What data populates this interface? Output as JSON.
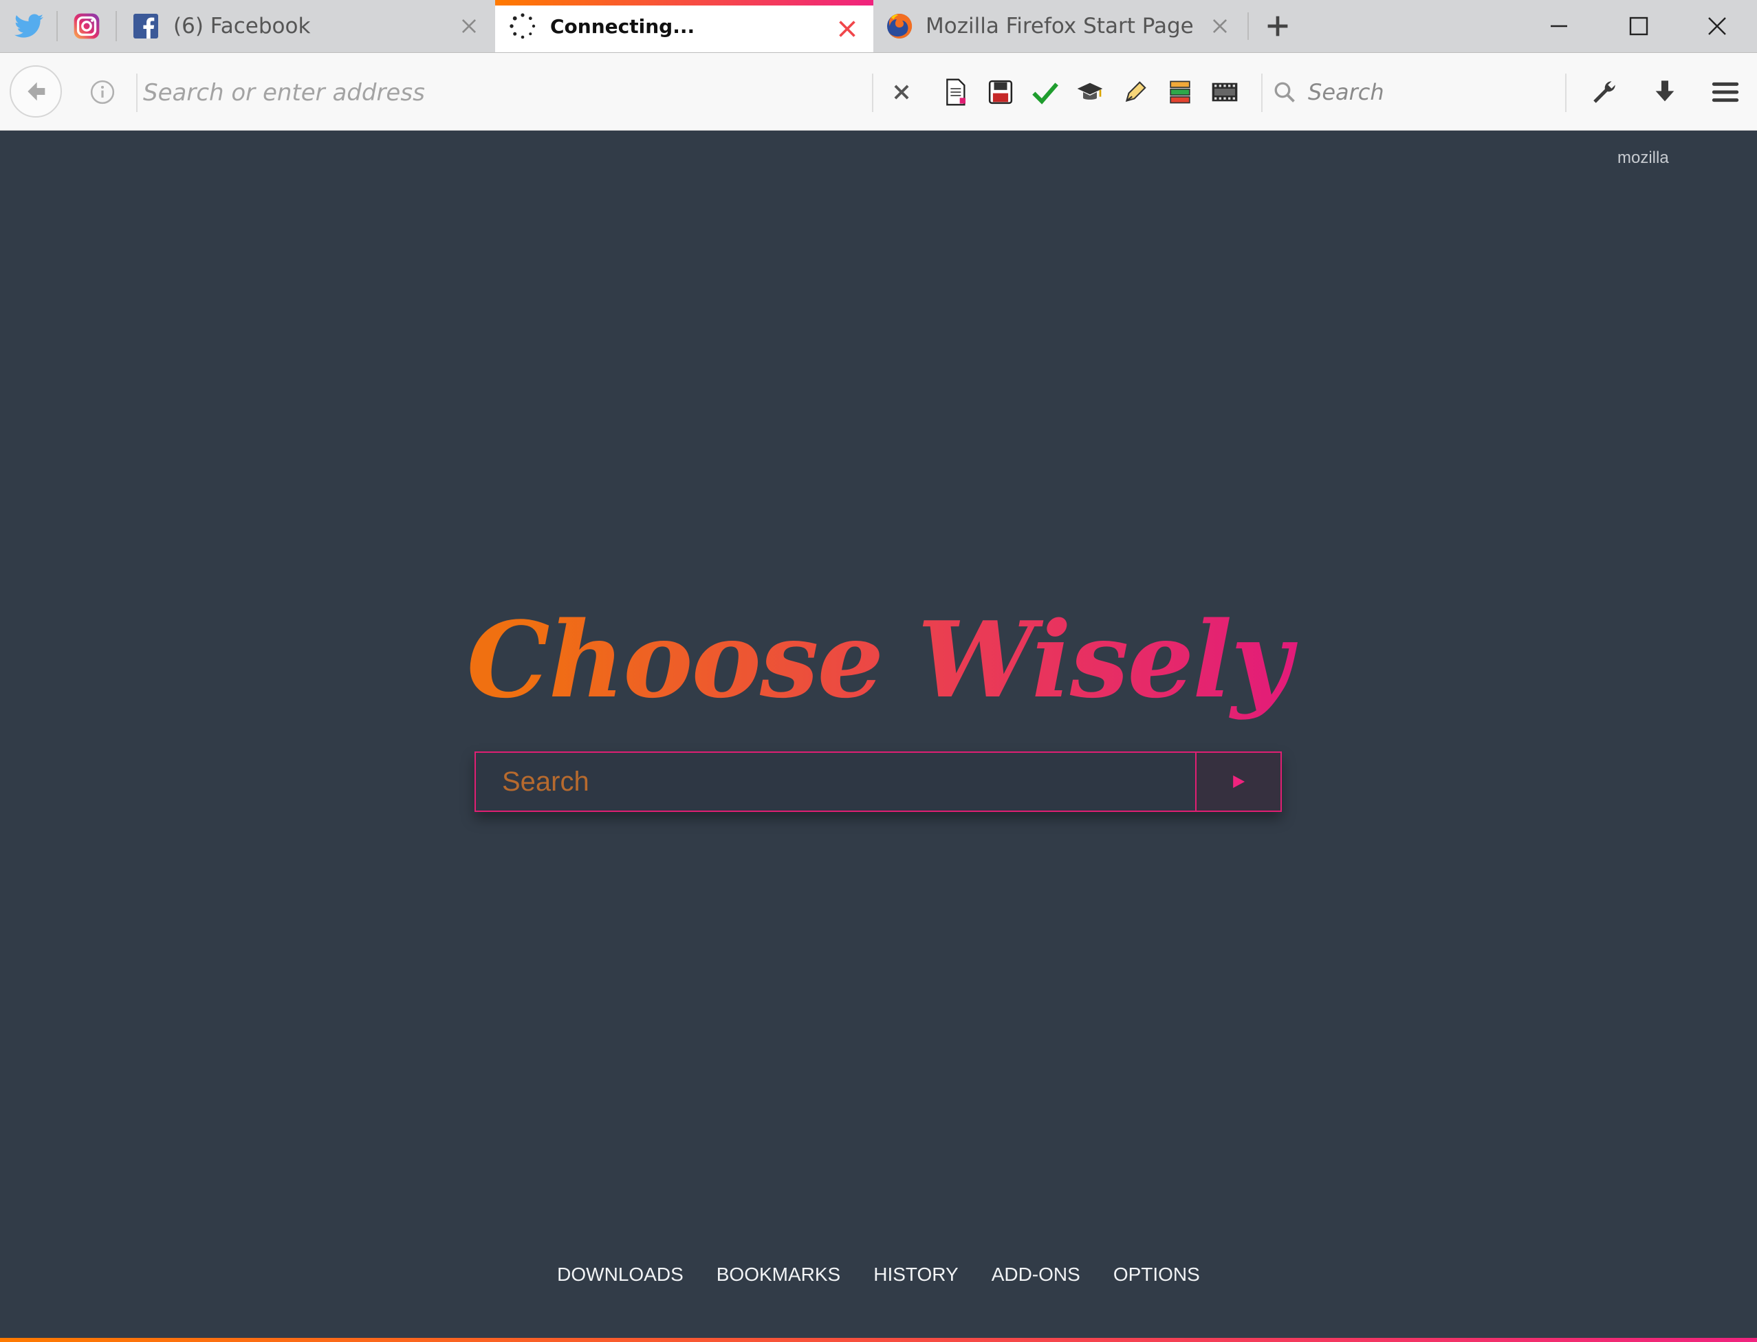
{
  "tabs": {
    "pinned": [
      {
        "name": "twitter",
        "icon": "twitter-icon"
      },
      {
        "name": "instagram",
        "icon": "instagram-icon"
      }
    ],
    "items": [
      {
        "label": "(6) Facebook",
        "icon": "facebook-icon",
        "active": false
      },
      {
        "label": "Connecting...",
        "icon": "loading-spinner-icon",
        "active": true
      },
      {
        "label": "Mozilla Firefox Start Page",
        "icon": "firefox-icon",
        "active": false
      }
    ],
    "new_tab_icon": "plus-icon"
  },
  "window_controls": [
    "minimize-icon",
    "maximize-icon",
    "close-icon"
  ],
  "navbar": {
    "address_placeholder": "Search or enter address",
    "search_placeholder": "Search",
    "toolbar_icons": [
      "stop-icon",
      "new-document-icon",
      "save-icon",
      "checkmark-icon",
      "graduation-cap-icon",
      "pen-icon",
      "stack-icon",
      "film-icon"
    ],
    "right_icons": [
      "wrench-icon",
      "download-icon",
      "menu-icon"
    ]
  },
  "page": {
    "corner_link": "mozilla",
    "hero_title": "Choose Wisely",
    "search_placeholder": "Search",
    "footer_links": [
      "DOWNLOADS",
      "BOOKMARKS",
      "HISTORY",
      "ADD-ONS",
      "OPTIONS"
    ]
  },
  "colors": {
    "background": "#323c48",
    "accent_orange": "#ff7a00",
    "accent_pink": "#f0237e",
    "tab_close_active": "#f0464a"
  }
}
